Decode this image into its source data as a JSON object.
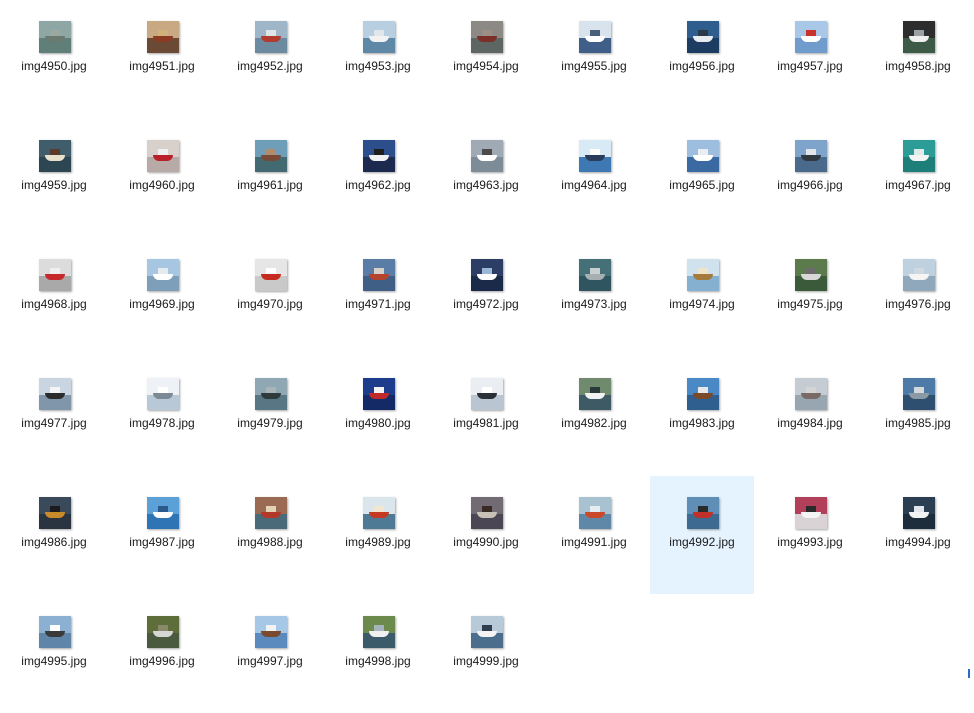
{
  "files": [
    {
      "name": "img4950.jpg",
      "sky": "#8fa7a4",
      "sea": "#5f7f78",
      "hull": "#6b7a70",
      "deck": "#9aa8a0"
    },
    {
      "name": "img4951.jpg",
      "sky": "#c9a984",
      "sea": "#6a4a34",
      "hull": "#8a3b22",
      "deck": "#d2b07a"
    },
    {
      "name": "img4952.jpg",
      "sky": "#9fb6c8",
      "sea": "#6c8aa0",
      "hull": "#b23a2e",
      "deck": "#dfe4e6"
    },
    {
      "name": "img4953.jpg",
      "sky": "#b7cfe0",
      "sea": "#5f88a6",
      "hull": "#f2f2f2",
      "deck": "#e0e6ea"
    },
    {
      "name": "img4954.jpg",
      "sky": "#8d8a86",
      "sea": "#5d6663",
      "hull": "#7b2f28",
      "deck": "#9b8e84"
    },
    {
      "name": "img4955.jpg",
      "sky": "#d9e3ee",
      "sea": "#3f5e88",
      "hull": "#ffffff",
      "deck": "#4a5f7a"
    },
    {
      "name": "img4956.jpg",
      "sky": "#2f5d8e",
      "sea": "#1c3c62",
      "hull": "#e8ecf0",
      "deck": "#2a3a4a"
    },
    {
      "name": "img4957.jpg",
      "sky": "#a9c7e6",
      "sea": "#6f9ccc",
      "hull": "#ffffff",
      "deck": "#c8342b"
    },
    {
      "name": "img4958.jpg",
      "sky": "#2d2d2d",
      "sea": "#3c5a46",
      "hull": "#f0f0f0",
      "deck": "#9aa0a4"
    },
    {
      "name": "img4959.jpg",
      "sky": "#3f5d6a",
      "sea": "#2c4652",
      "hull": "#e9e1cc",
      "deck": "#5a3a2a"
    },
    {
      "name": "img4960.jpg",
      "sky": "#d7d0cb",
      "sea": "#b8aaa6",
      "hull": "#b8202a",
      "deck": "#eeeeee"
    },
    {
      "name": "img4961.jpg",
      "sky": "#6f9fb8",
      "sea": "#436a70",
      "hull": "#7a4a36",
      "deck": "#b18c6e"
    },
    {
      "name": "img4962.jpg",
      "sky": "#2c4e8a",
      "sea": "#1b2a4e",
      "hull": "#f2f2f2",
      "deck": "#1e1e1e"
    },
    {
      "name": "img4963.jpg",
      "sky": "#9faab4",
      "sea": "#7e8c98",
      "hull": "#ffffff",
      "deck": "#4a4a4a"
    },
    {
      "name": "img4964.jpg",
      "sky": "#d8eaf6",
      "sea": "#3f79b3",
      "hull": "#2a3e5c",
      "deck": "#ffffff"
    },
    {
      "name": "img4965.jpg",
      "sky": "#9ebee0",
      "sea": "#3b6aa2",
      "hull": "#ffffff",
      "deck": "#e9eef4"
    },
    {
      "name": "img4966.jpg",
      "sky": "#7fa4cc",
      "sea": "#4a6a8c",
      "hull": "#303840",
      "deck": "#e2e6ea"
    },
    {
      "name": "img4967.jpg",
      "sky": "#2c9c96",
      "sea": "#1e7f7a",
      "hull": "#f4f4f4",
      "deck": "#dfeaea"
    },
    {
      "name": "img4968.jpg",
      "sky": "#dcdcdc",
      "sea": "#a9a9a9",
      "hull": "#c6282b",
      "deck": "#efefef"
    },
    {
      "name": "img4969.jpg",
      "sky": "#a7c6e2",
      "sea": "#7e9fb9",
      "hull": "#ffffff",
      "deck": "#e6ebf0"
    },
    {
      "name": "img4970.jpg",
      "sky": "#e6e6e6",
      "sea": "#c9c9c9",
      "hull": "#c52b1e",
      "deck": "#ffffff"
    },
    {
      "name": "img4971.jpg",
      "sky": "#5a7da8",
      "sea": "#3f5f86",
      "hull": "#b6432e",
      "deck": "#d8d0c8"
    },
    {
      "name": "img4972.jpg",
      "sky": "#2c3e66",
      "sea": "#1c2a4a",
      "hull": "#ffffff",
      "deck": "#9bb8d6"
    },
    {
      "name": "img4973.jpg",
      "sky": "#457078",
      "sea": "#2e5560",
      "hull": "#a6b0b2",
      "deck": "#c9cfd0"
    },
    {
      "name": "img4974.jpg",
      "sky": "#cfe2ee",
      "sea": "#86b0d0",
      "hull": "#a67a3a",
      "deck": "#f0e4c6"
    },
    {
      "name": "img4975.jpg",
      "sky": "#5b7b4c",
      "sea": "#3b5a3a",
      "hull": "#d8d8d8",
      "deck": "#6b6b6b"
    },
    {
      "name": "img4976.jpg",
      "sky": "#bfd0de",
      "sea": "#90a8bc",
      "hull": "#f5f5f5",
      "deck": "#d0d8e0"
    },
    {
      "name": "img4977.jpg",
      "sky": "#c9d5e0",
      "sea": "#7f96ab",
      "hull": "#2c2c2c",
      "deck": "#f4f4f4"
    },
    {
      "name": "img4978.jpg",
      "sky": "#eef2f6",
      "sea": "#b8c8d6",
      "hull": "#7c8a96",
      "deck": "#ffffff"
    },
    {
      "name": "img4979.jpg",
      "sky": "#8fa8b4",
      "sea": "#587684",
      "hull": "#2e3a3c",
      "deck": "#a8b4b8"
    },
    {
      "name": "img4980.jpg",
      "sky": "#1e3c8c",
      "sea": "#142a66",
      "hull": "#c12a2a",
      "deck": "#f2f2f2"
    },
    {
      "name": "img4981.jpg",
      "sky": "#eaeef2",
      "sea": "#b9c6d2",
      "hull": "#2b2f36",
      "deck": "#ffffff"
    },
    {
      "name": "img4982.jpg",
      "sky": "#6f8a6c",
      "sea": "#3e5a64",
      "hull": "#f2f2f2",
      "deck": "#2a3a3a"
    },
    {
      "name": "img4983.jpg",
      "sky": "#4a88c6",
      "sea": "#2e5f8e",
      "hull": "#7a4a2a",
      "deck": "#e8e8e8"
    },
    {
      "name": "img4984.jpg",
      "sky": "#c5ccd4",
      "sea": "#98a6b2",
      "hull": "#7a6a66",
      "deck": "#d4d4d4"
    },
    {
      "name": "img4985.jpg",
      "sky": "#4d7aa6",
      "sea": "#2e4f70",
      "hull": "#8a9aa4",
      "deck": "#d2d8dc"
    },
    {
      "name": "img4986.jpg",
      "sky": "#3a4a5a",
      "sea": "#2a3440",
      "hull": "#c98a2a",
      "deck": "#1c1c1c"
    },
    {
      "name": "img4987.jpg",
      "sky": "#5ba0d6",
      "sea": "#2f74b4",
      "hull": "#ffffff",
      "deck": "#2a5a8a"
    },
    {
      "name": "img4988.jpg",
      "sky": "#9a6a52",
      "sea": "#4a6a7a",
      "hull": "#b2382a",
      "deck": "#e4d2b6"
    },
    {
      "name": "img4989.jpg",
      "sky": "#dbe6ec",
      "sea": "#4e7a96",
      "hull": "#c53a22",
      "deck": "#f2e6cf"
    },
    {
      "name": "img4990.jpg",
      "sky": "#726b74",
      "sea": "#4a4654",
      "hull": "#c9c0b8",
      "deck": "#3a2a24"
    },
    {
      "name": "img4991.jpg",
      "sky": "#a9c2d2",
      "sea": "#5f88a8",
      "hull": "#c94a2a",
      "deck": "#e6edf2"
    },
    {
      "name": "img4992.jpg",
      "sky": "#5f8fb6",
      "sea": "#3d6a90",
      "hull": "#c2302a",
      "deck": "#2a2a2a"
    },
    {
      "name": "img4993.jpg",
      "sky": "#b2405a",
      "sea": "#d9d3d6",
      "hull": "#f4f4f4",
      "deck": "#2a2a2a"
    },
    {
      "name": "img4994.jpg",
      "sky": "#2c3e52",
      "sea": "#1d2d3c",
      "hull": "#f2f2f2",
      "deck": "#dfe5ea"
    },
    {
      "name": "img4995.jpg",
      "sky": "#8bb0d2",
      "sea": "#5f86a8",
      "hull": "#3a3a3a",
      "deck": "#ffffff"
    },
    {
      "name": "img4996.jpg",
      "sky": "#5d6e3a",
      "sea": "#4a5a3e",
      "hull": "#d6d6d6",
      "deck": "#8a8a6a"
    },
    {
      "name": "img4997.jpg",
      "sky": "#a6c8e6",
      "sea": "#5b8abf",
      "hull": "#7a4a2e",
      "deck": "#f2f2f2"
    },
    {
      "name": "img4998.jpg",
      "sky": "#6c8a4c",
      "sea": "#3b5a6a",
      "hull": "#f0f0f0",
      "deck": "#a6b4bc"
    },
    {
      "name": "img4999.jpg",
      "sky": "#b8cad8",
      "sea": "#4a6e8c",
      "hull": "#f4f4f4",
      "deck": "#2e3e4e"
    }
  ],
  "selected_index": 42,
  "colors": {
    "background": "#ffffff",
    "selection": "#e5f3ff",
    "text": "#1a1a1a"
  }
}
